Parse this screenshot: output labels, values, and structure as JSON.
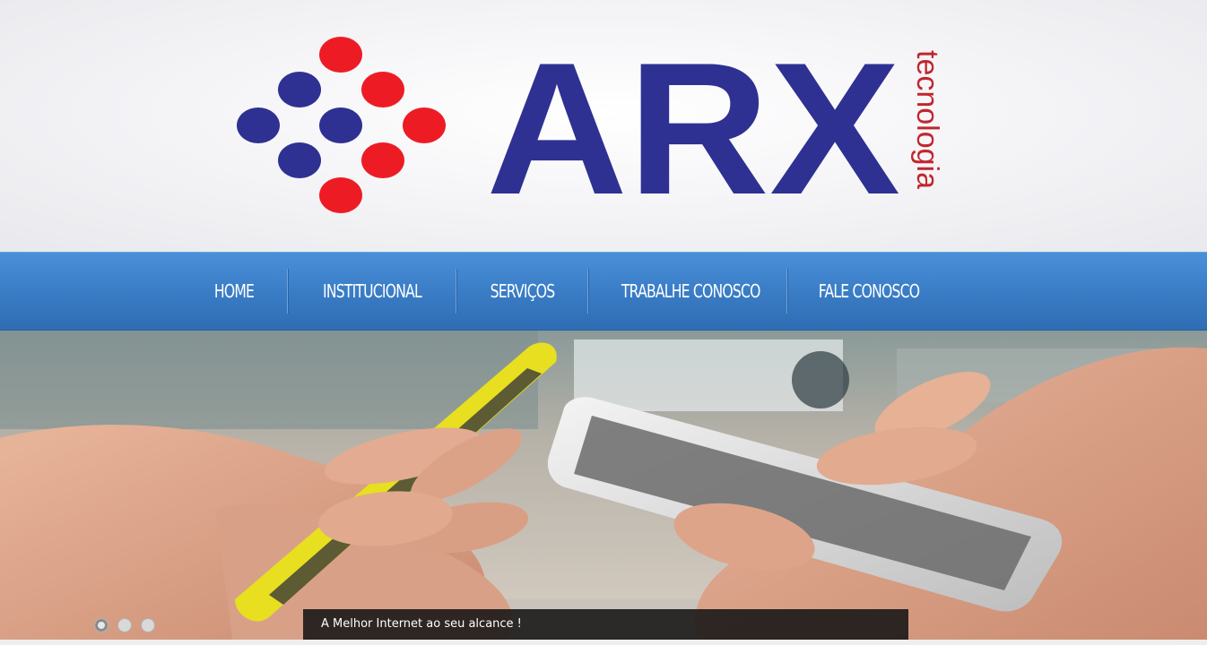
{
  "brand": {
    "logo_text": "ARX",
    "logo_subtext": "tecnologia",
    "colors": {
      "blue": "#2e3192",
      "red": "#ed1c24"
    }
  },
  "nav": {
    "items": [
      {
        "label": "HOME"
      },
      {
        "label": "INSTITUCIONAL"
      },
      {
        "label": "SERVIÇOS"
      },
      {
        "label": "TRABALHE CONOSCO"
      },
      {
        "label": "FALE CONOSCO"
      }
    ],
    "background": "#3b7fc8"
  },
  "slider": {
    "caption": "A Melhor Internet ao seu alcance !",
    "slide_count": 3,
    "active_index": 0
  }
}
